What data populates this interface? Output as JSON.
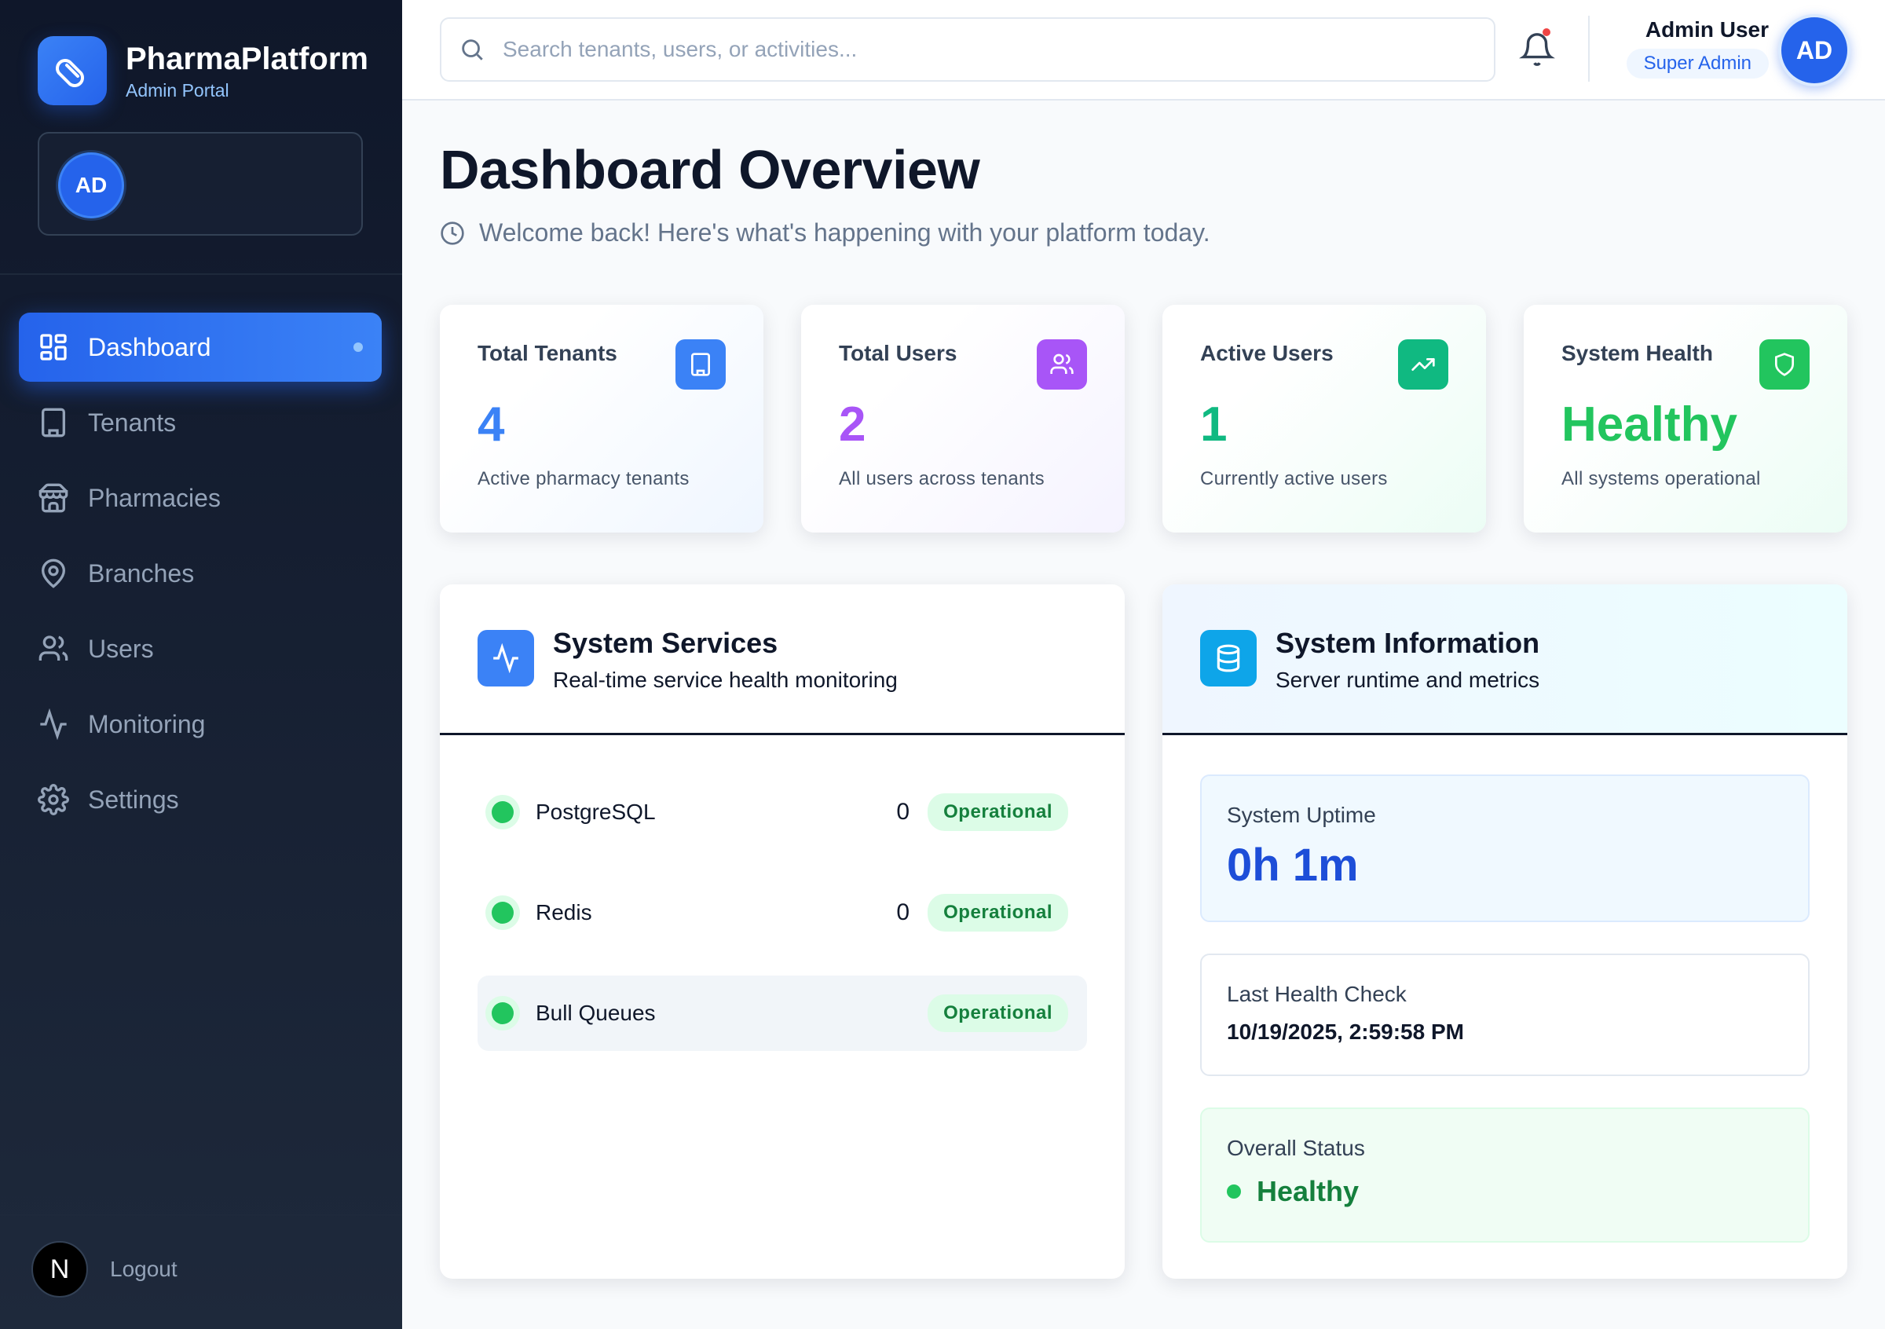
{
  "brand": {
    "name": "PharmaPlatform",
    "subtitle": "Admin Portal",
    "icon": "pill-icon",
    "accent": "#2563eb"
  },
  "sidebar": {
    "user_initials": "AD",
    "items": [
      {
        "label": "Dashboard",
        "icon": "grid-icon",
        "active": true
      },
      {
        "label": "Tenants",
        "icon": "building-icon"
      },
      {
        "label": "Pharmacies",
        "icon": "store-icon"
      },
      {
        "label": "Branches",
        "icon": "map-pin-icon"
      },
      {
        "label": "Users",
        "icon": "users-icon"
      },
      {
        "label": "Monitoring",
        "icon": "activity-icon"
      },
      {
        "label": "Settings",
        "icon": "gear-icon"
      }
    ],
    "footer_badge": "N",
    "logout_label": "Logout"
  },
  "topbar": {
    "search_placeholder": "Search tenants, users, or activities...",
    "user_name": "Admin User",
    "user_role": "Super Admin",
    "user_initials": "AD"
  },
  "page": {
    "title": "Dashboard Overview",
    "subtitle": "Welcome back! Here's what's happening with your platform today."
  },
  "stats": [
    {
      "label": "Total Tenants",
      "value": "4",
      "desc": "Active pharmacy tenants",
      "color": "#3b82f6",
      "icon": "building-icon"
    },
    {
      "label": "Total Users",
      "value": "2",
      "desc": "All users across tenants",
      "color": "#a855f7",
      "icon": "users-icon"
    },
    {
      "label": "Active Users",
      "value": "1",
      "desc": "Currently active users",
      "color": "#10b981",
      "icon": "trending-up-icon"
    },
    {
      "label": "System Health",
      "value": "Healthy",
      "desc": "All systems operational",
      "color": "#22c55e",
      "icon": "shield-icon"
    }
  ],
  "services_panel": {
    "title": "System Services",
    "subtitle": "Real-time service health monitoring",
    "services": [
      {
        "name": "PostgreSQL",
        "count": "0",
        "status": "Operational"
      },
      {
        "name": "Redis",
        "count": "0",
        "status": "Operational"
      },
      {
        "name": "Bull Queues",
        "count": "",
        "status": "Operational"
      }
    ]
  },
  "info_panel": {
    "title": "System Information",
    "subtitle": "Server runtime and metrics",
    "uptime_label": "System Uptime",
    "uptime_value": "0h 1m",
    "health_check_label": "Last Health Check",
    "health_check_value": "10/19/2025, 2:59:58 PM",
    "overall_label": "Overall Status",
    "overall_value": "Healthy"
  }
}
